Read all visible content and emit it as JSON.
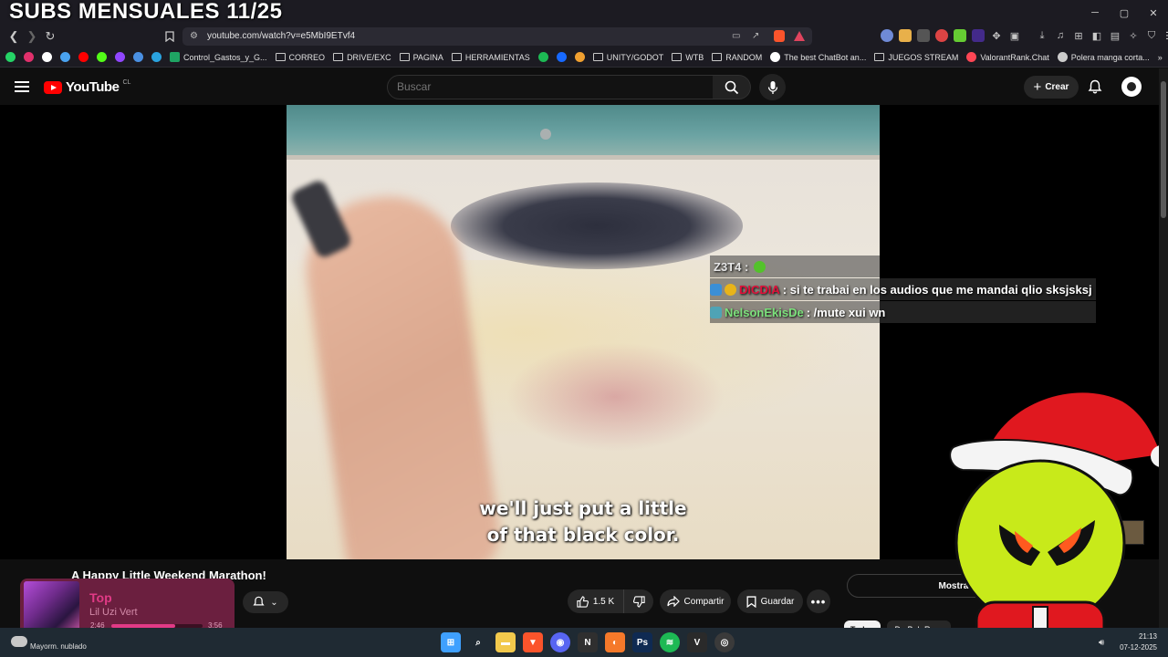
{
  "window": {
    "tab_text": "",
    "controls": {
      "minimize": "─",
      "maximize": "▢",
      "close": "✕"
    }
  },
  "overlay": {
    "stream_title": "SUBS MENSUALES 11/25"
  },
  "browser": {
    "url": "youtube.com/watch?v=e5MbI9ETvf4",
    "bookmarks": [
      {
        "label": "",
        "icon": "whatsapp-icon",
        "color": "#25d366"
      },
      {
        "label": "",
        "icon": "instagram-icon",
        "color": "#e1306c"
      },
      {
        "label": "",
        "icon": "x-icon",
        "color": "#ffffff"
      },
      {
        "label": "",
        "icon": "onedrive-icon",
        "color": "#4aa3f0"
      },
      {
        "label": "",
        "icon": "youtube-icon",
        "color": "#ff0000"
      },
      {
        "label": "",
        "icon": "kick-icon",
        "color": "#53fc18"
      },
      {
        "label": "",
        "icon": "twitch-icon",
        "color": "#9146ff"
      },
      {
        "label": "",
        "icon": "pencil-icon",
        "color": "#4a90e2"
      },
      {
        "label": "",
        "icon": "telegram-icon",
        "color": "#2aa3df"
      },
      {
        "label": "Control_Gastos_y_G...",
        "icon": "sheets-icon",
        "color": "#1fa463"
      },
      {
        "label": "CORREO",
        "icon": "folder-icon",
        "color": ""
      },
      {
        "label": "DRIVE/EXC",
        "icon": "folder-icon",
        "color": ""
      },
      {
        "label": "PAGINA",
        "icon": "folder-icon",
        "color": ""
      },
      {
        "label": "HERRAMIENTAS",
        "icon": "folder-icon",
        "color": ""
      },
      {
        "label": "",
        "icon": "green-circle-icon",
        "color": "#1db954"
      },
      {
        "label": "",
        "icon": "behance-icon",
        "color": "#1769ff"
      },
      {
        "label": "",
        "icon": "orange-icon",
        "color": "#f0a030"
      },
      {
        "label": "UNITY/GODOT",
        "icon": "folder-icon",
        "color": ""
      },
      {
        "label": "WTB",
        "icon": "folder-icon",
        "color": ""
      },
      {
        "label": "RANDOM",
        "icon": "folder-icon",
        "color": ""
      },
      {
        "label": "The best ChatBot an...",
        "icon": "chatbot-icon",
        "color": "#ffffff"
      },
      {
        "label": "JUEGOS STREAM",
        "icon": "folder-icon",
        "color": ""
      },
      {
        "label": "ValorantRank.Chat",
        "icon": "valorant-icon",
        "color": "#ff4655"
      },
      {
        "label": "Polera manga corta...",
        "icon": "globe-icon",
        "color": "#cccccc"
      }
    ]
  },
  "youtube": {
    "logo_text": "YouTube",
    "region": "CL",
    "search_placeholder": "Buscar",
    "create_label": "Crear",
    "caption_line1": "we'll just put a little",
    "caption_line2": "of that black color.",
    "video_title": "A Happy Little Weekend Marathon!",
    "like_count": "1.5 K",
    "share_label": "Compartir",
    "save_label": "Guardar",
    "show_chat_label": "Mostrar chat",
    "chip_all": "Todos",
    "chip_bob": "De Bob Ross"
  },
  "chat": {
    "messages": [
      {
        "user": "Z3T4 :",
        "text": ""
      },
      {
        "user": "DICDIA",
        "text": ": si te trabai en los audios que me mandai qlio sksjsksj"
      },
      {
        "user": "NelsonEkisDe",
        "text": ": /mute xui wn"
      }
    ]
  },
  "music": {
    "title": "Top",
    "artist": "Lil Uzi Vert",
    "elapsed": "2:46",
    "total": "3:56",
    "progress": 0.7
  },
  "taskbar": {
    "weather_text": "Mayorm. nublado",
    "time": "21:13",
    "date": "07-12-2025",
    "apps": [
      "windows-icon",
      "search-icon",
      "explorer-icon",
      "brave-icon",
      "discord-icon",
      "notion-icon",
      "blender-icon",
      "photoshop-icon",
      "spotify-icon",
      "valorant-icon",
      "obs-icon"
    ]
  },
  "colors": {
    "yt_red": "#ff0000",
    "bg": "#0f0f0f",
    "music_accent": "#e13a86"
  }
}
